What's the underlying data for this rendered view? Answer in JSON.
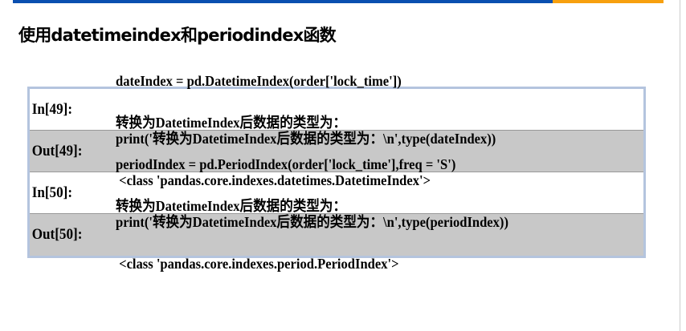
{
  "colors": {
    "top_bar_primary": "#0a4fb0",
    "top_bar_accent": "#f7a00f",
    "table_border": "#b4c4de",
    "output_row_bg": "#c8c8c8"
  },
  "title": "使用datetimeindex和periodindex函数",
  "cells": [
    {
      "label": "In[49]:",
      "lines": [
        "dateIndex = pd.DatetimeIndex(order['lock_time'])",
        "print('转换为DatetimeIndex后数据的类型为：\\n',type(dateIndex))"
      ]
    },
    {
      "label": "Out[49]:",
      "lines": [
        "转换为DatetimeIndex后数据的类型为：",
        " <class 'pandas.core.indexes.datetimes.DatetimeIndex'>"
      ]
    },
    {
      "label": "In[50]:",
      "lines": [
        "periodIndex = pd.PeriodIndex(order['lock_time'],freq = 'S')",
        "print('转换为DatetimeIndex后数据的类型为：\\n',type(periodIndex))"
      ]
    },
    {
      "label": "Out[50]:",
      "lines": [
        "转换为DatetimeIndex后数据的类型为：",
        " <class 'pandas.core.indexes.period.PeriodIndex'>"
      ]
    }
  ]
}
